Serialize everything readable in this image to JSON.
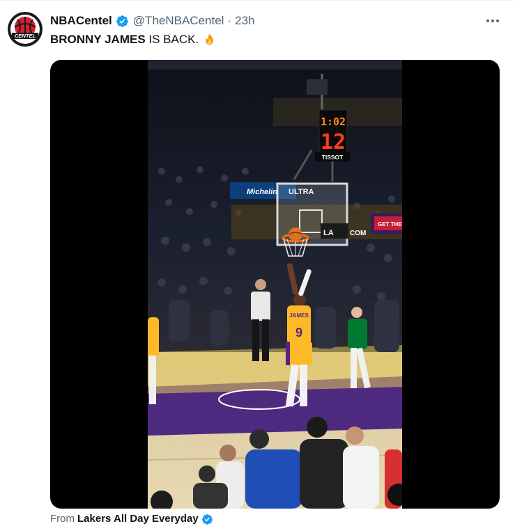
{
  "tweet": {
    "display_name": "NBACentel",
    "handle": "@TheNBACentel",
    "separator": "·",
    "time": "23h",
    "text_bold": "BRONNY JAMES",
    "text_rest": " IS BACK.",
    "emoji_icon": "fire-icon",
    "avatar_text": "CENTEL"
  },
  "media": {
    "shot_clock_time": "1:02",
    "shot_clock_value": "12",
    "shot_clock_brand": "TISSOT",
    "arena_ad_left": "Michelin",
    "arena_ad_mid": "ULTRA",
    "arena_ad_right": "GET THE",
    "backboard_ad": "LA",
    "backboard_ad_2": "COM",
    "jersey_name": "JAMES",
    "jersey_number": "9"
  },
  "from": {
    "label": "From",
    "source": "Lakers All Day Everyday"
  },
  "colors": {
    "verified": "#1d9bf0",
    "text": "#0f1419",
    "muted": "#536471",
    "lakers_gold": "#fdb927",
    "lakers_purple": "#552583",
    "celtics_green": "#007a33"
  }
}
